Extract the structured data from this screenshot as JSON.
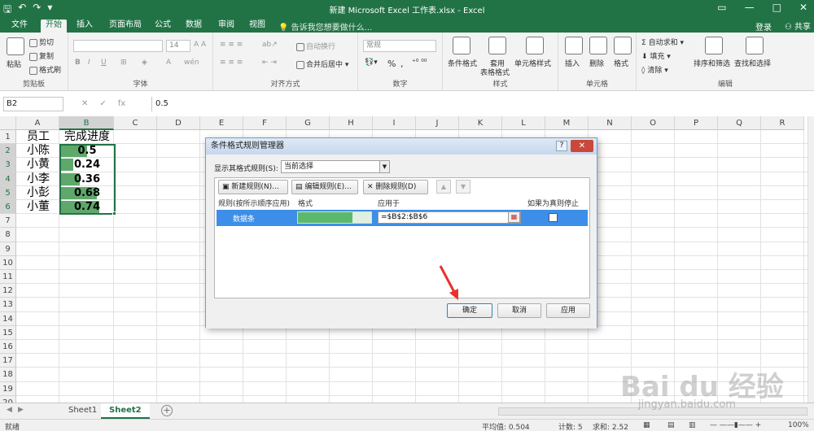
{
  "window": {
    "title": "新建 Microsoft Excel 工作表.xlsx - Excel"
  },
  "tabs": [
    {
      "label": "文件"
    },
    {
      "label": "开始"
    },
    {
      "label": "插入"
    },
    {
      "label": "页面布局"
    },
    {
      "label": "公式"
    },
    {
      "label": "数据"
    },
    {
      "label": "审阅"
    },
    {
      "label": "视图"
    }
  ],
  "tellme": "告诉我您想要做什么...",
  "account": {
    "login": "登录",
    "share": "共享"
  },
  "ribbon": {
    "clipboard": {
      "paste": "粘贴",
      "cut": "剪切",
      "copy": "复制",
      "format_painter": "格式刷",
      "label": "剪贴板"
    },
    "font": {
      "size": "14",
      "label": "字体"
    },
    "align": {
      "wrap": "自动换行",
      "merge": "合并后居中",
      "label": "对齐方式"
    },
    "number": {
      "format": "常规",
      "percent": "%",
      "label": "数字"
    },
    "styles": {
      "cond": "条件格式",
      "table": "套用表格格式",
      "table_l1": "套用",
      "table_l2": "表格格式",
      "cell": "单元格样式",
      "label": "样式"
    },
    "cells": {
      "insert": "插入",
      "delete": "删除",
      "format": "格式",
      "label": "单元格"
    },
    "editing": {
      "autosum": "自动求和",
      "fill": "填充",
      "clear": "清除",
      "sort": "排序和筛选",
      "find": "查找和选择",
      "label": "编辑"
    }
  },
  "formula_bar": {
    "name_box": "B2",
    "value": "0.5"
  },
  "columns": [
    "A",
    "B",
    "C",
    "D",
    "E",
    "F",
    "G",
    "H",
    "I",
    "J",
    "K",
    "L",
    "M",
    "N",
    "O",
    "P",
    "Q",
    "R"
  ],
  "rows": [
    "1",
    "2",
    "3",
    "4",
    "5",
    "6",
    "7",
    "8",
    "9",
    "10",
    "11",
    "12",
    "13",
    "14",
    "15",
    "16",
    "17",
    "18",
    "19",
    "20"
  ],
  "cells": {
    "header": {
      "a": "员工",
      "b": "完成进度"
    },
    "data": [
      {
        "name": "小陈",
        "value": "0.5",
        "fill": 0.5
      },
      {
        "name": "小黄",
        "value": "0.24",
        "fill": 0.24
      },
      {
        "name": "小李",
        "value": "0.36",
        "fill": 0.36
      },
      {
        "name": "小彭",
        "value": "0.68",
        "fill": 0.68
      },
      {
        "name": "小董",
        "value": "0.74",
        "fill": 0.74
      }
    ]
  },
  "sheets": [
    {
      "label": "Sheet1"
    },
    {
      "label": "Sheet2"
    }
  ],
  "status": {
    "ready": "就绪",
    "average": "平均值: 0.504",
    "count": "计数: 5",
    "sum": "求和: 2.52",
    "zoom": "100%"
  },
  "dialog": {
    "title": "条件格式规则管理器",
    "help": "?",
    "close": "✕",
    "show_label": "显示其格式规则(S):",
    "show_value": "当前选择",
    "new_rule": "新建规则(N)...",
    "edit_rule": "编辑规则(E)...",
    "delete_rule": "删除规则(D)",
    "col_rule": "规则(按所示顺序应用)",
    "col_format": "格式",
    "col_apply": "应用于",
    "col_stop": "如果为真则停止",
    "rule_name": "数据条",
    "rule_fill": 0.74,
    "apply_to": "=$B$2:$B$6",
    "ok": "确定",
    "cancel": "取消",
    "apply": "应用"
  },
  "watermark": {
    "text": "Bai du 经验",
    "url": "jingyan.baidu.com"
  },
  "colors": {
    "excel_green": "#217346",
    "databar": "#5fa86b",
    "selected_rule": "#3d8ee8",
    "arrow": "#e8322e"
  }
}
